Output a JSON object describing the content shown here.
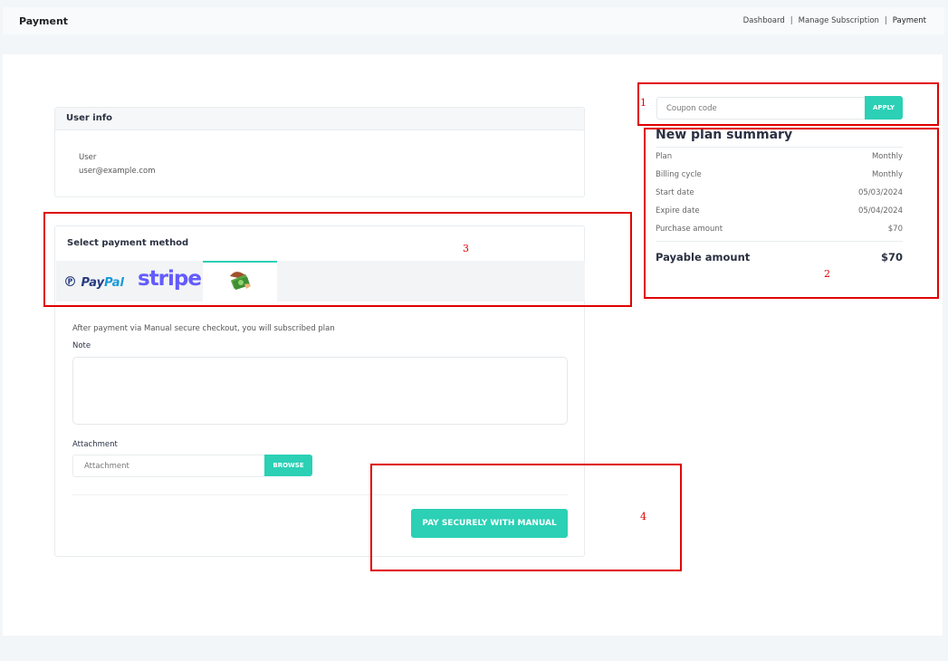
{
  "header": {
    "title": "Payment",
    "breadcrumb": {
      "item1": "Dashboard",
      "item2": "Manage Subscription",
      "item3": "Payment",
      "separator": "|"
    }
  },
  "user_info": {
    "heading": "User info",
    "name": "User",
    "email": "user@example.com"
  },
  "payment": {
    "heading": "Select payment method",
    "methods": {
      "paypal_a": "Pay",
      "paypal_b": "Pal",
      "stripe": "stripe",
      "manual_icon": "money-hand-icon"
    },
    "info": "After payment via Manual secure checkout, you will subscribed plan",
    "note_label": "Note",
    "attachment_label": "Attachment",
    "attachment_placeholder": "Attachment",
    "browse_label": "BROWSE",
    "pay_button": "PAY SECURELY WITH MANUAL"
  },
  "coupon": {
    "placeholder": "Coupon code",
    "apply_label": "APPLY"
  },
  "summary": {
    "title": "New plan summary",
    "rows": [
      {
        "label": "Plan",
        "value": "Monthly"
      },
      {
        "label": "Billing cycle",
        "value": "Monthly"
      },
      {
        "label": "Start date",
        "value": "05/03/2024"
      },
      {
        "label": "Expire date",
        "value": "05/04/2024"
      },
      {
        "label": "Purchase amount",
        "value": "$70"
      }
    ],
    "payable_label": "Payable amount",
    "payable_value": "$70"
  },
  "annotations": [
    "1",
    "2",
    "3",
    "4"
  ],
  "colors": {
    "accent": "#2bd0b5",
    "annotation": "#e00000",
    "paypal_dark": "#253b80",
    "paypal_light": "#179bd7",
    "stripe": "#635bff"
  }
}
